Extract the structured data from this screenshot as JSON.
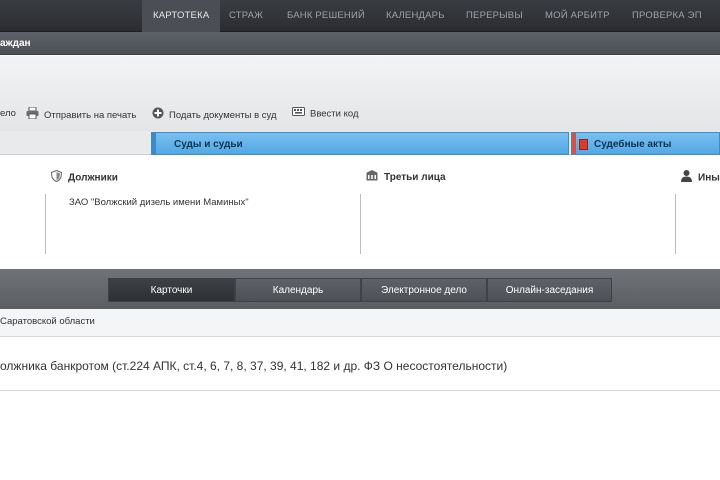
{
  "topnav": {
    "items": [
      "КАРТОТЕКА",
      "СТРАЖ",
      "БАНК РЕШЕНИЙ",
      "КАЛЕНДАРЬ",
      "ПЕРЕРЫВЫ",
      "МОЙ АРБИТР",
      "ПРОВЕРКА ЭП"
    ],
    "active_index": 0
  },
  "subbar": {
    "title": "аждан"
  },
  "toolbar": {
    "partial_label": "ело",
    "print_label": "Отправить на печать",
    "submit_docs_label": "Подать документы в суд",
    "enter_code_label": "Ввести код"
  },
  "tabs": {
    "courts_judges": "Суды и судьи",
    "judicial_acts": "Судебные акты"
  },
  "participants": {
    "debtors_header": "Должники",
    "third_parties_header": "Третьи лица",
    "others_header": "Ины",
    "debtors": [
      "ЗАО \"Волжский дизель имени Маминых\""
    ]
  },
  "bottom_nav": {
    "items": [
      "Карточки",
      "Календарь",
      "Электронное дело",
      "Онлайн-заседания"
    ],
    "active_index": 0
  },
  "court_name": "Саратовской области",
  "case_category": "олжника банкротом (ст.224 АПК, ст.4, 6, 7, 8, 37, 39, 41, 182 и др. ФЗ О несостоятельности)",
  "colors": {
    "tab_blue": "#5fb0e8",
    "topnav_bg": "#2f3236",
    "bottom_bar": "#64686d"
  }
}
